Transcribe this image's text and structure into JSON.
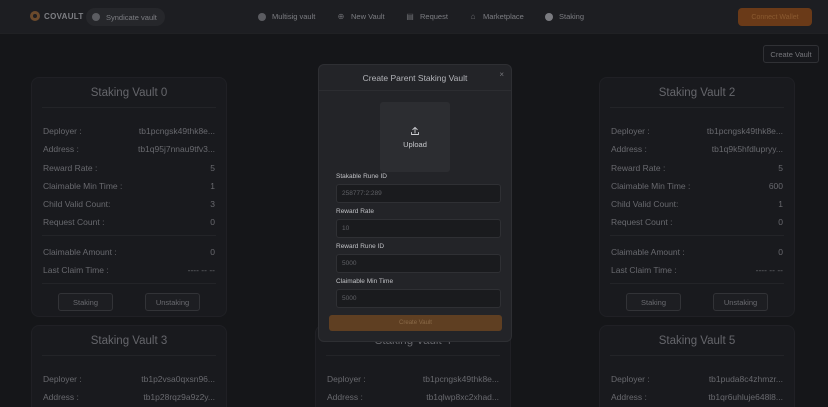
{
  "nav": {
    "brand": "COVAULT",
    "syndicate_label": "Syndicate vault",
    "links": {
      "multisig": "Multisig vault",
      "new_vault": "New Vault",
      "request": "Request",
      "marketplace": "Marketplace",
      "staking": "Staking"
    },
    "connect_label": "Connect Wallet"
  },
  "create_vault_label": "Create Vault",
  "labels": {
    "deployer": "Deployer :",
    "address": "Address :",
    "reward_rate": "Reward Rate :",
    "claimable_min_time": "Claimable Min Time :",
    "child_valid_count": "Child Valid Count:",
    "request_count": "Request Count :",
    "claimable_amount": "Claimable Amount :",
    "last_claim_time": "Last Claim Time :",
    "staking": "Staking",
    "unstaking": "Unstaking"
  },
  "vaults": [
    {
      "title": "Staking Vault 0",
      "deployer": "tb1pcngsk49thk8e...",
      "address": "tb1q95j7nnau9tfv3...",
      "reward_rate": "5",
      "claimable_min_time": "1",
      "child_valid_count": "3",
      "request_count": "0",
      "claimable_amount": "0",
      "last_claim_time": "---- -- --"
    },
    {
      "title": "Staking Vault 2",
      "deployer": "tb1pcngsk49thk8e...",
      "address": "tb1q9k5hfdlupryy...",
      "reward_rate": "5",
      "claimable_min_time": "600",
      "child_valid_count": "1",
      "request_count": "0",
      "claimable_amount": "0",
      "last_claim_time": "---- -- --"
    },
    {
      "title": "Staking Vault 3",
      "deployer": "tb1p2vsa0qxsn96...",
      "address": "tb1p28rqz9a9z2y..."
    },
    {
      "title": "Staking Vault 4",
      "deployer": "tb1pcngsk49thk8e...",
      "address": "tb1qlwp8xc2xhad..."
    },
    {
      "title": "Staking Vault 5",
      "deployer": "tb1puda8c4zhmzr...",
      "address": "tb1qr6uhluje648l8..."
    }
  ],
  "modal": {
    "title": "Create Parent Staking Vault",
    "close": "×",
    "upload_label": "Upload",
    "fields": [
      {
        "label": "Stakable Rune ID",
        "placeholder": "258777:2:289"
      },
      {
        "label": "Reward Rate",
        "placeholder": "10"
      },
      {
        "label": "Reward Rune ID",
        "placeholder": "5000"
      },
      {
        "label": "Claimable Min Time",
        "placeholder": "5000"
      }
    ],
    "submit_label": "Create Vault"
  },
  "colors": {
    "background": "#191a1d",
    "card": "#1e1f23",
    "modal": "#232428",
    "accent": "#6a3a18"
  }
}
